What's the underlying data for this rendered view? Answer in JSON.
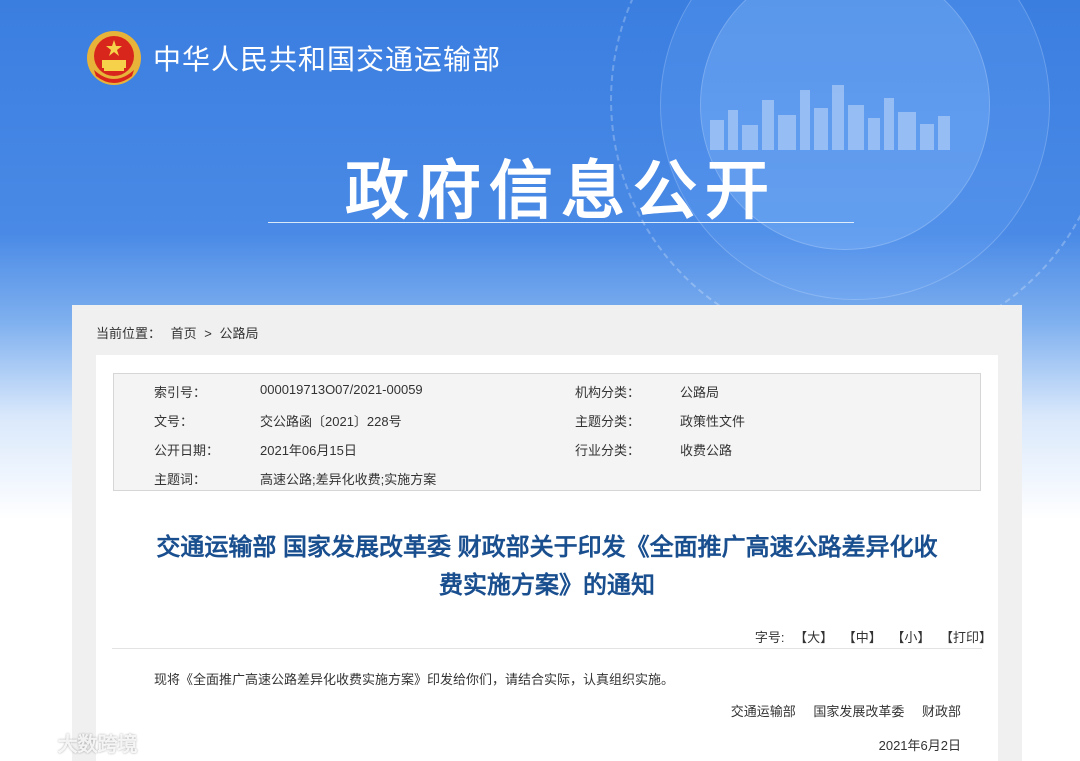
{
  "header": {
    "ministry_name": "中华人民共和国交通运输部",
    "section_title": "政府信息公开"
  },
  "breadcrumb": {
    "label": "当前位置：",
    "home": "首页",
    "separator": ">",
    "current": "公路局"
  },
  "meta": {
    "index_label": "索引号：",
    "index_value": "000019713O07/2021-00059",
    "org_label": "机构分类：",
    "org_value": "公路局",
    "docno_label": "文号：",
    "docno_value": "交公路函〔2021〕228号",
    "topic_label": "主题分类：",
    "topic_value": "政策性文件",
    "date_label": "公开日期：",
    "date_value": "2021年06月15日",
    "industry_label": "行业分类：",
    "industry_value": "收费公路",
    "keywords_label": "主题词：",
    "keywords_value": "高速公路;差异化收费;实施方案"
  },
  "document": {
    "title_line1": "交通运输部 国家发展改革委 财政部关于印发《全面推广高速公路差异化收",
    "title_line2": "费实施方案》的通知",
    "body": "现将《全面推广高速公路差异化收费实施方案》印发给你们，请结合实际，认真组织实施。",
    "signer1": "交通运输部",
    "signer2": "国家发展改革委",
    "signer3": "财政部",
    "sign_date": "2021年6月2日"
  },
  "font_size_bar": {
    "label": "字号:",
    "large": "【大】",
    "medium": "【中】",
    "small": "【小】",
    "print": "【打印】"
  },
  "watermark": {
    "text": "大数跨境"
  },
  "colors": {
    "banner_blue": "#3a7ee0",
    "title_blue": "#1a4f8f",
    "panel_gray": "#f0f0f0"
  }
}
